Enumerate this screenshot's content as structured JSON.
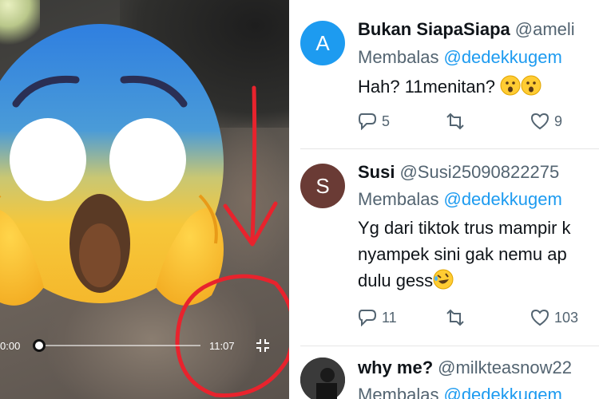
{
  "video": {
    "current_time": "0:00",
    "duration": "11:07",
    "progress": 0,
    "emoji_icon": "face-screaming-in-fear",
    "fullscreen_icon": "exit-fullscreen-icon",
    "annotation_color": "#e8232d"
  },
  "tweets": [
    {
      "avatar_letter": "A",
      "avatar_color": "#1d9bf0",
      "display_name": "Bukan SiapaSiapa",
      "handle": "@ameli",
      "reply_prefix": "Membalas",
      "reply_to": "@dedekkugem",
      "lines": [
        "Hah? 11menitan?"
      ],
      "trailing_emoji": "hushed-face x2",
      "replies": "5",
      "retweets": "",
      "likes": "9"
    },
    {
      "avatar_letter": "S",
      "avatar_color": "#6a3b35",
      "display_name": "Susi",
      "handle": "@Susi25090822275",
      "reply_prefix": "Membalas",
      "reply_to": "@dedekkugem",
      "lines": [
        "Yg dari tiktok trus mampir k",
        "nyampek sini gak nemu ap",
        "dulu gess"
      ],
      "trailing_emoji": "rolling-on-the-floor-laughing",
      "replies": "11",
      "retweets": "",
      "likes": "103"
    },
    {
      "avatar_letter": "",
      "avatar_color": "#2b2b2b",
      "display_name": "why me?",
      "handle": "@milkteasnow22",
      "reply_prefix": "Membalas",
      "reply_to": "@dedekkugem",
      "lines": [],
      "replies": "",
      "retweets": "",
      "likes": ""
    }
  ]
}
